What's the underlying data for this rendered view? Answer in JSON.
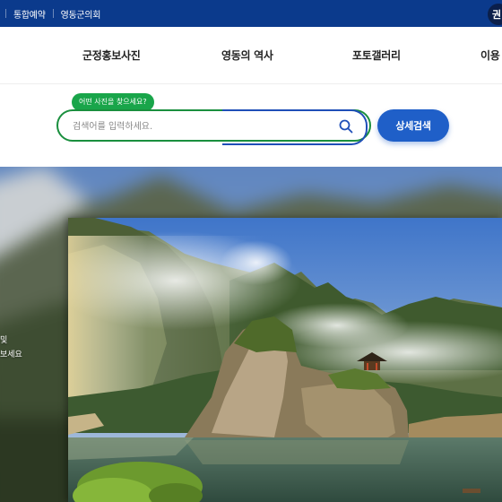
{
  "utilbar": {
    "links": [
      "통합예약",
      "영동군의회"
    ],
    "circle_label": "권"
  },
  "gnb": {
    "items": [
      "군정홍보사진",
      "영동의 역사",
      "포토갤러리",
      "이용"
    ]
  },
  "search": {
    "tooltip": "어떤 사진을 찾으세요?",
    "placeholder": "검색어를 입력하세요.",
    "value": "",
    "icon": "search-icon",
    "detail_label": "상세검색"
  },
  "bg_side_text": {
    "line1": "및",
    "line2": "보세요"
  },
  "colors": {
    "utilbar": "#0b3a8c",
    "tooltip": "#19a54a",
    "search_border": "#1a8f3e",
    "accent": "#1f5fc8"
  }
}
